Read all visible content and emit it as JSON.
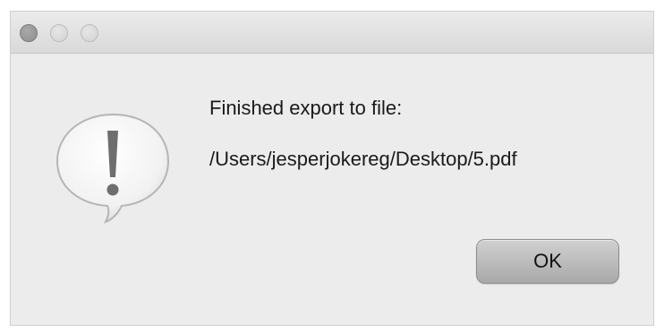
{
  "window": {
    "traffic_lights": [
      "close",
      "minimize",
      "zoom"
    ]
  },
  "alert": {
    "icon": "alert-exclamation-icon",
    "message": "Finished export to file:",
    "file_path": "/Users/jesperjokereg/Desktop/5.pdf"
  },
  "buttons": {
    "ok_label": "OK"
  },
  "colors": {
    "dialog_background": "#ececec",
    "button_gray": "#b8b8b8"
  }
}
